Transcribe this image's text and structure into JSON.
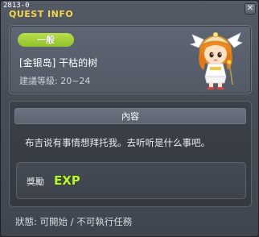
{
  "window": {
    "id_label": "2813-0",
    "title": "QUEST INFO",
    "close_symbol": "✕"
  },
  "quest": {
    "category": "一般",
    "name": "[金银岛] 干枯的树",
    "level_label": "建議等級: 20~24"
  },
  "description": {
    "header": "內容",
    "text": "布吉说有事情想拜托我。去听听是什么事吧。"
  },
  "reward": {
    "label": "獎勵",
    "icon": "exp-icon",
    "icon_text": "EXP"
  },
  "status": {
    "text": "狀態: 可開始 / 不可執行任務"
  },
  "colors": {
    "title_gold": "#f5d54a",
    "badge_green": "#9fcd33",
    "exp_green": "#b9f23a"
  }
}
